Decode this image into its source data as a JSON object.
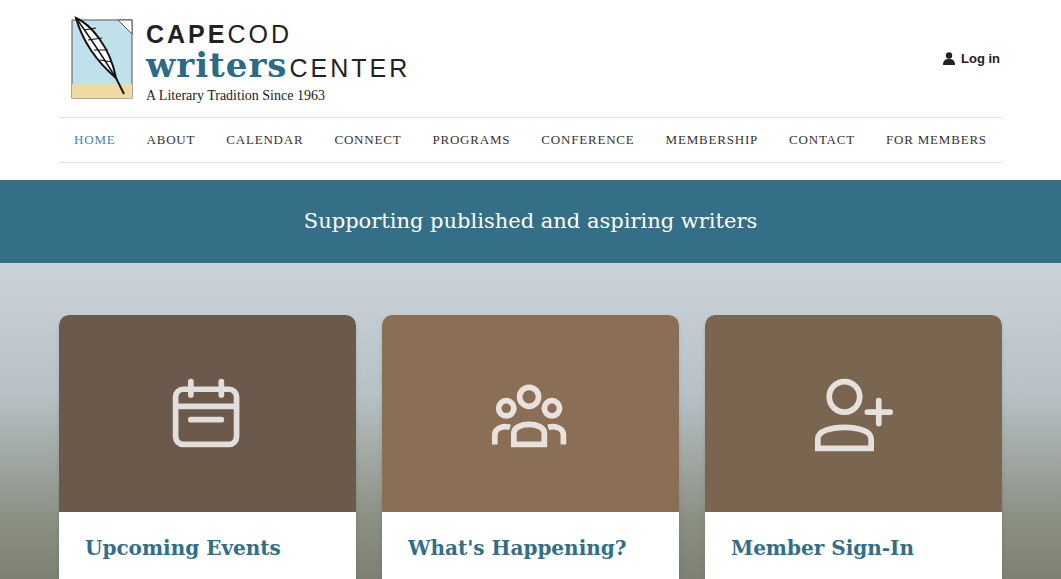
{
  "logo": {
    "cape": "CAPE",
    "cod": "COD",
    "writers": "writers",
    "center": "CENTER",
    "tagline": "A Literary Tradition Since 1963"
  },
  "login": {
    "label": "Log in"
  },
  "nav": [
    {
      "label": "HOME",
      "selected": true
    },
    {
      "label": "ABOUT",
      "selected": false
    },
    {
      "label": "CALENDAR",
      "selected": false
    },
    {
      "label": "CONNECT",
      "selected": false
    },
    {
      "label": "PROGRAMS",
      "selected": false
    },
    {
      "label": "CONFERENCE",
      "selected": false
    },
    {
      "label": "MEMBERSHIP",
      "selected": false
    },
    {
      "label": "CONTACT",
      "selected": false
    },
    {
      "label": "FOR MEMBERS",
      "selected": false
    }
  ],
  "banner": {
    "text": "Supporting published and aspiring writers"
  },
  "cards": [
    {
      "title": "Upcoming Events",
      "kind": "calendar"
    },
    {
      "title": "What's Happening?",
      "kind": "community"
    },
    {
      "title": "Member Sign-In",
      "kind": "signin"
    }
  ]
}
